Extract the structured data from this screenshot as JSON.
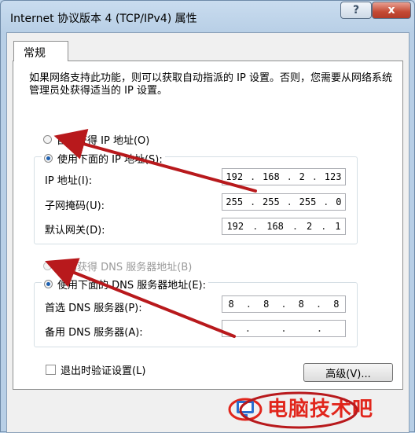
{
  "window": {
    "title": "Internet 协议版本 4 (TCP/IPv4) 属性",
    "help_icon": "?",
    "close_icon": "x"
  },
  "tab": {
    "label": "常规"
  },
  "description": "如果网络支持此功能，则可以获取自动指派的 IP 设置。否则，您需要从网络系统管理员处获得适当的 IP 设置。",
  "ip_section": {
    "auto_label": "自动获得 IP 地址(O)",
    "manual_label": "使用下面的 IP 地址(S):",
    "fields": [
      {
        "label": "IP 地址(I):",
        "octets": [
          "192",
          "168",
          "2",
          "123"
        ]
      },
      {
        "label": "子网掩码(U):",
        "octets": [
          "255",
          "255",
          "255",
          "0"
        ]
      },
      {
        "label": "默认网关(D):",
        "octets": [
          "192",
          "168",
          "2",
          "1"
        ]
      }
    ]
  },
  "dns_section": {
    "auto_label": "自动获得 DNS 服务器地址(B)",
    "manual_label": "使用下面的 DNS 服务器地址(E):",
    "fields": [
      {
        "label": "首选 DNS 服务器(P):",
        "octets": [
          "8",
          "8",
          "8",
          "8"
        ]
      },
      {
        "label": "备用 DNS 服务器(A):",
        "octets": [
          "",
          "",
          "",
          ""
        ]
      }
    ]
  },
  "validate_label": "退出时验证设置(L)",
  "advanced_button": "高级(V)...",
  "watermark": "电脑技术吧",
  "colors": {
    "arrow": "#b8191c",
    "watermark": "#e1261c",
    "selected_radio": "#1c5fb0"
  }
}
